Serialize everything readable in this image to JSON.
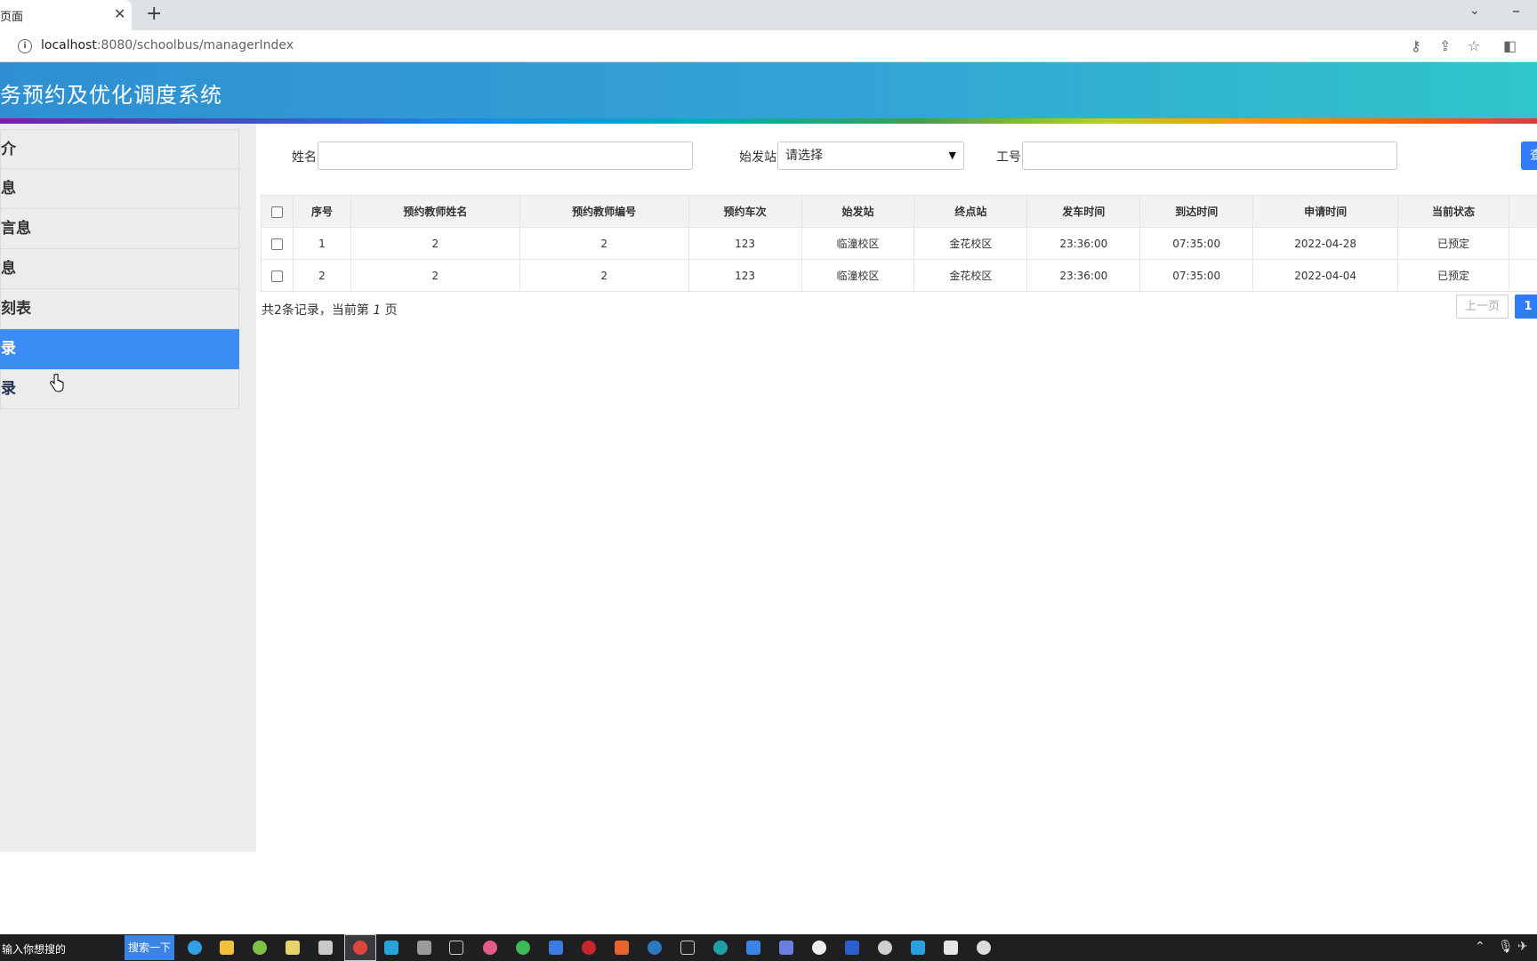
{
  "browser": {
    "tab_title": "页面",
    "tab_close": "✕",
    "new_tab": "+",
    "url_host": "localhost",
    "url_rest": ":8080/schoolbus/managerIndex"
  },
  "app": {
    "title": "务预约及优化调度系统"
  },
  "sidebar": {
    "items": [
      {
        "label": "介"
      },
      {
        "label": "息"
      },
      {
        "label": "言息"
      },
      {
        "label": "息"
      },
      {
        "label": "刻表"
      },
      {
        "label": "录"
      },
      {
        "label": "录"
      }
    ],
    "active_index": 5
  },
  "search": {
    "name_label": "姓名",
    "name_value": "",
    "station_label": "始发站",
    "station_value": "请选择",
    "id_label": "工号",
    "id_value": "",
    "button_label": "查"
  },
  "table": {
    "columns": [
      "序号",
      "预约教师姓名",
      "预约教师编号",
      "预约车次",
      "始发站",
      "终点站",
      "发车时间",
      "到达时间",
      "申请时间",
      "当前状态"
    ],
    "rows": [
      [
        "1",
        "2",
        "2",
        "123",
        "临潼校区",
        "金花校区",
        "23:36:00",
        "07:35:00",
        "2022-04-28",
        "已预定"
      ],
      [
        "2",
        "2",
        "2",
        "123",
        "临潼校区",
        "金花校区",
        "23:36:00",
        "07:35:00",
        "2022-04-04",
        "已预定"
      ]
    ]
  },
  "pagination": {
    "summary_pre": "共2条记录，当前第 ",
    "summary_page": "1",
    "summary_post": " 页",
    "prev_label": "上一页",
    "current_page": "1"
  },
  "taskbar": {
    "search_placeholder": "输入你想搜的",
    "search_button": "搜索一下"
  },
  "colors": {
    "accent": "#3b8cf5",
    "header_start": "#2f8fd2",
    "header_end": "#2ec7c9",
    "sidebar_bg": "#ececec"
  }
}
